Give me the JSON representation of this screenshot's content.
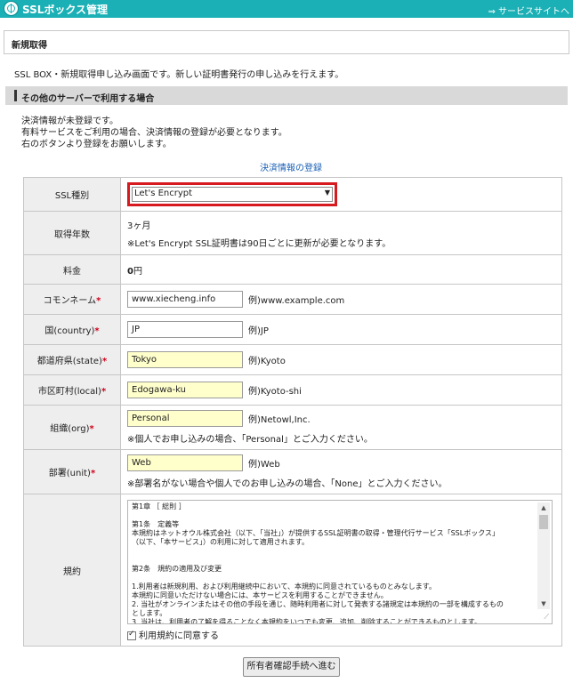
{
  "header": {
    "app_title": "SSLボックス管理",
    "service_link": "⇒ サービスサイトへ",
    "logo_icon": "ssl-globe-logo",
    "color": "#1ab0b5"
  },
  "page": {
    "title": "新規取得",
    "intro": "SSL BOX・新規取得申し込み画面です。新しい証明書発行の申し込みを行えます。"
  },
  "section": {
    "title": "その他のサーバーで利用する場合"
  },
  "notice": {
    "line1": "決済情報が未登録です。",
    "line2": "有料サービスをご利用の場合、決済情報の登録が必要となります。",
    "line3": "右のボタンより登録をお願いします。",
    "link": "決済情報の登録"
  },
  "form": {
    "ssl_type": {
      "label": "SSL種別",
      "value": "Let's Encrypt"
    },
    "period": {
      "label": "取得年数",
      "value": "3ヶ月",
      "note": "※Let's Encrypt SSL証明書は90日ごとに更新が必要となります。"
    },
    "price": {
      "label": "料金",
      "value": "0",
      "unit": "円"
    },
    "common_name": {
      "label": "コモンネーム",
      "value": "www.xiecheng.info",
      "example": "例)www.example.com"
    },
    "country": {
      "label": "国(country)",
      "value": "JP",
      "example": "例)JP"
    },
    "state": {
      "label": "都道府県(state)",
      "value": "Tokyo",
      "example": "例)Kyoto"
    },
    "locality": {
      "label": "市区町村(local)",
      "value": "Edogawa-ku",
      "example": "例)Kyoto-shi"
    },
    "org": {
      "label": "組織(org)",
      "value": "Personal",
      "example": "例)Netowl,Inc.",
      "note": "※個人でお申し込みの場合、「Personal」とご入力ください。"
    },
    "unit": {
      "label": "部署(unit)",
      "value": "Web",
      "example": "例)Web",
      "note": "※部署名がない場合や個人でのお申し込みの場合、「None」とご入力ください。"
    },
    "terms": {
      "label": "規約",
      "lines": [
        "第1章 ［ 総則 ］",
        "",
        "第1条　定義等",
        "本規約はネットオウル株式会社（以下、「当社」）が提供するSSL証明書の取得・管理代行サービス「SSLボックス」",
        "（以下、「本サービス」）の利用に対して適用されます。",
        "",
        "",
        "第2条　規約の適用及び変更",
        "",
        "1.利用者は新規利用、および利用継続中において、本規約に同意されているものとみなします。",
        "本規約に同意いただけない場合には、本サービスを利用することができません。",
        "2. 当社がオンラインまたはその他の手段を通じ、随時利用者に対して発表する諸規定は本規約の一部を構成するもの",
        "とします。",
        "3. 当社は、利用者の了解を得ることなく本規約をいつでも変更、追加、削除することができるものとします。"
      ],
      "agree_label": "利用規約に同意する",
      "agree_checked": true
    },
    "required_mark": "*"
  },
  "submit": {
    "label": "所有者確認手続へ進む"
  }
}
